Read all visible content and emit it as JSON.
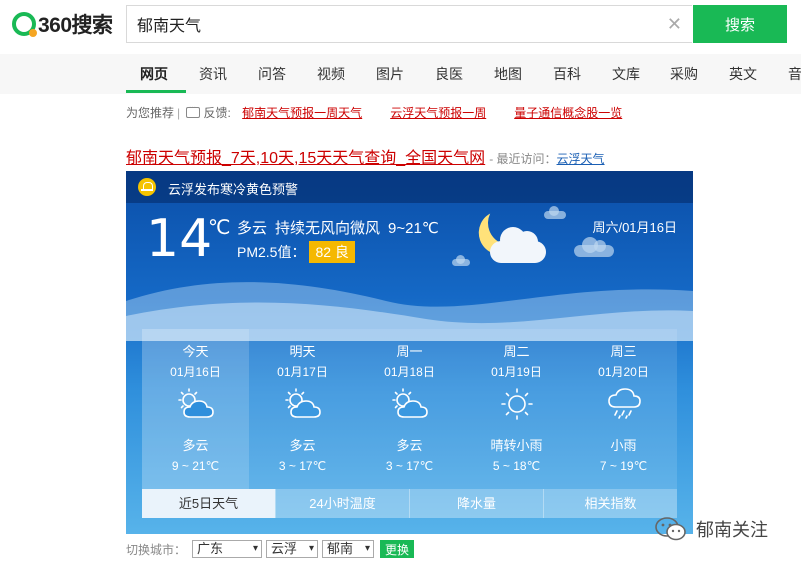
{
  "brand": {
    "logo_text": "360搜索"
  },
  "search": {
    "query": "郁南天气",
    "button_label": "搜索"
  },
  "nav": {
    "items": [
      "网页",
      "资讯",
      "问答",
      "视频",
      "图片",
      "良医",
      "地图",
      "百科",
      "文库",
      "采购",
      "英文",
      "音"
    ],
    "active_index": 0
  },
  "recommend": {
    "label": "为您推荐",
    "feedback_label": "反馈:",
    "links": [
      "郁南天气预报一周天气",
      "云浮天气预报一周",
      "量子通信概念股一览"
    ]
  },
  "result": {
    "title": "郁南天气预报_7天,10天,15天天气查询_全国天气网",
    "recent_label": "- 最近访问：",
    "recent_link": "云浮天气"
  },
  "weather": {
    "alert": "云浮发布寒冷黄色预警",
    "current_temp": "14",
    "temp_unit": "℃",
    "condition": "多云",
    "wind": "持续无风向微风",
    "range": "9~21℃",
    "pm_label": "PM2.5值：",
    "pm_value": "82 良",
    "date": "周六/01月16日",
    "forecast": [
      {
        "name": "今天",
        "date": "01月16日",
        "icon": "partly-cloudy-icon",
        "cond": "多云",
        "range": "9 ~ 21℃"
      },
      {
        "name": "明天",
        "date": "01月17日",
        "icon": "partly-cloudy-icon",
        "cond": "多云",
        "range": "3 ~ 17℃"
      },
      {
        "name": "周一",
        "date": "01月18日",
        "icon": "partly-cloudy-icon",
        "cond": "多云",
        "range": "3 ~ 17℃"
      },
      {
        "name": "周二",
        "date": "01月19日",
        "icon": "sun-icon",
        "cond": "晴转小雨",
        "range": "5 ~ 18℃"
      },
      {
        "name": "周三",
        "date": "01月20日",
        "icon": "rain-cloud-icon",
        "cond": "小雨",
        "range": "7 ~ 19℃"
      }
    ],
    "tabs": [
      "近5日天气",
      "24小时温度",
      "降水量",
      "相关指数"
    ],
    "active_tab": 0
  },
  "switch_city": {
    "label": "切换城市：",
    "province": "广东",
    "city": "云浮",
    "county": "郁南",
    "button": "更换"
  },
  "watermark": {
    "text": "郁南关注"
  },
  "colors": {
    "accent": "#19b955",
    "link_red": "#cc0000",
    "pm_badge": "#f5b800"
  }
}
